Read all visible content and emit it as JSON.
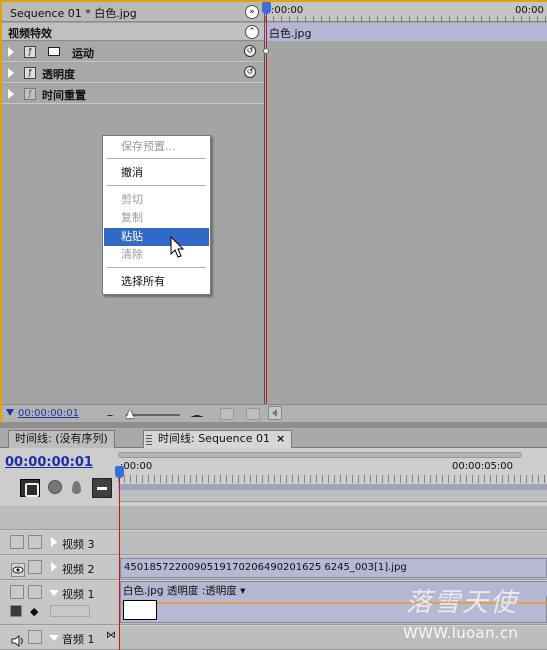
{
  "effect_controls": {
    "sequence_title": "Sequence 01 * 白色.jpg",
    "ruler_start": ":00:00",
    "ruler_end": "00:00",
    "section_header": "视频特效",
    "clip_name": "白色.jpg",
    "effects": [
      {
        "label": "运动"
      },
      {
        "label": "透明度"
      },
      {
        "label": "时间重置"
      }
    ],
    "timecode": "00:00:00:01"
  },
  "context_menu": {
    "items": [
      {
        "label": "保存预置...",
        "disabled": true
      },
      {
        "label": "撤消",
        "disabled": false
      },
      {
        "label": "剪切",
        "disabled": true
      },
      {
        "label": "复制",
        "disabled": true
      },
      {
        "label": "粘贴",
        "disabled": false,
        "selected": true
      },
      {
        "label": "清除",
        "disabled": true
      },
      {
        "label": "选择所有",
        "disabled": false
      }
    ]
  },
  "timeline": {
    "tabs": [
      {
        "label": "时间线: (没有序列)"
      },
      {
        "label": "时间线: Sequence 01"
      }
    ],
    "timecode": "00:00:00:01",
    "ruler_start": ":00:00",
    "ruler_end": "00:00:05:00",
    "tracks": [
      {
        "name": "视频 3"
      },
      {
        "name": "视频 2"
      },
      {
        "name": "视频 1"
      },
      {
        "name": "音频 1"
      }
    ],
    "clip_v2": "4501857220090519170206490201625 6245_003[1].jpg",
    "clip_v1": "白色.jpg 透明度 :透明度 ▾"
  },
  "watermark": {
    "logo_text": "落雪天使",
    "url": "WWW.luoan.cn"
  },
  "colors": {
    "accent_orange": "#e2a30a",
    "selection_blue": "#3169c6",
    "playhead_red": "#c41d1d",
    "clip_lavender": "#b7b8d4",
    "timecode_blue": "#1d2fa6"
  }
}
